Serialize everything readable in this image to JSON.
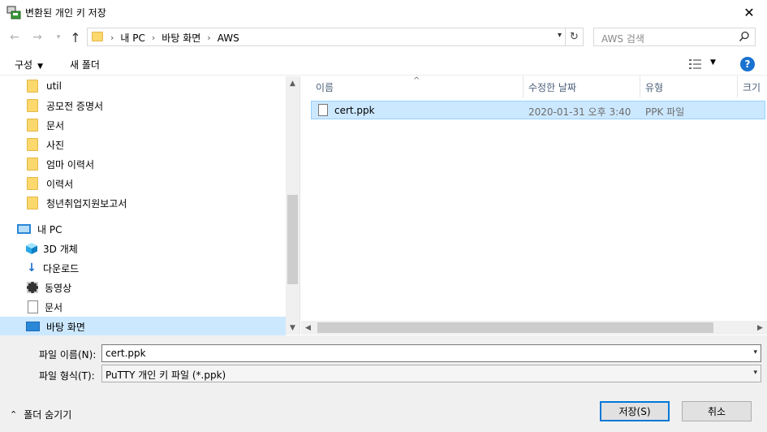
{
  "window": {
    "title": "변환된 개인 키 저장",
    "close": "✕"
  },
  "address": {
    "crumbs": [
      "내 PC",
      "바탕 화면",
      "AWS"
    ],
    "search_placeholder": "AWS 검색"
  },
  "toolbar": {
    "organize": "구성",
    "new_folder": "새 폴더",
    "help": "?"
  },
  "tree": [
    {
      "label": "util",
      "icon": "folder"
    },
    {
      "label": "공모전 증명서",
      "icon": "folder"
    },
    {
      "label": "문서",
      "icon": "folder"
    },
    {
      "label": "사진",
      "icon": "folder"
    },
    {
      "label": "엄마 이력서",
      "icon": "folder"
    },
    {
      "label": "이력서",
      "icon": "folder"
    },
    {
      "label": "청년취업지원보고서",
      "icon": "folder"
    },
    {
      "label": "내 PC",
      "icon": "pc"
    },
    {
      "label": "3D 개체",
      "icon": "cube"
    },
    {
      "label": "다운로드",
      "icon": "download"
    },
    {
      "label": "동영상",
      "icon": "video"
    },
    {
      "label": "문서",
      "icon": "document"
    },
    {
      "label": "바탕 화면",
      "icon": "desktop",
      "selected": true
    }
  ],
  "columns": {
    "name": "이름",
    "date": "수정한 날짜",
    "type": "유형",
    "size": "크기"
  },
  "files": [
    {
      "name": "cert.ppk",
      "date": "2020-01-31 오후 3:40",
      "type": "PPK 파일"
    }
  ],
  "form": {
    "filename_label": "파일 이름(N):",
    "filename_value": "cert.ppk",
    "filetype_label": "파일 형식(T):",
    "filetype_value": "PuTTY 개인 키 파일 (*.ppk)",
    "hide_folders": "폴더 숨기기",
    "save": "저장(S)",
    "cancel": "취소"
  },
  "colors": {
    "selection": "#cce8ff",
    "accent": "#0078d7",
    "folder": "#fcd86d"
  }
}
